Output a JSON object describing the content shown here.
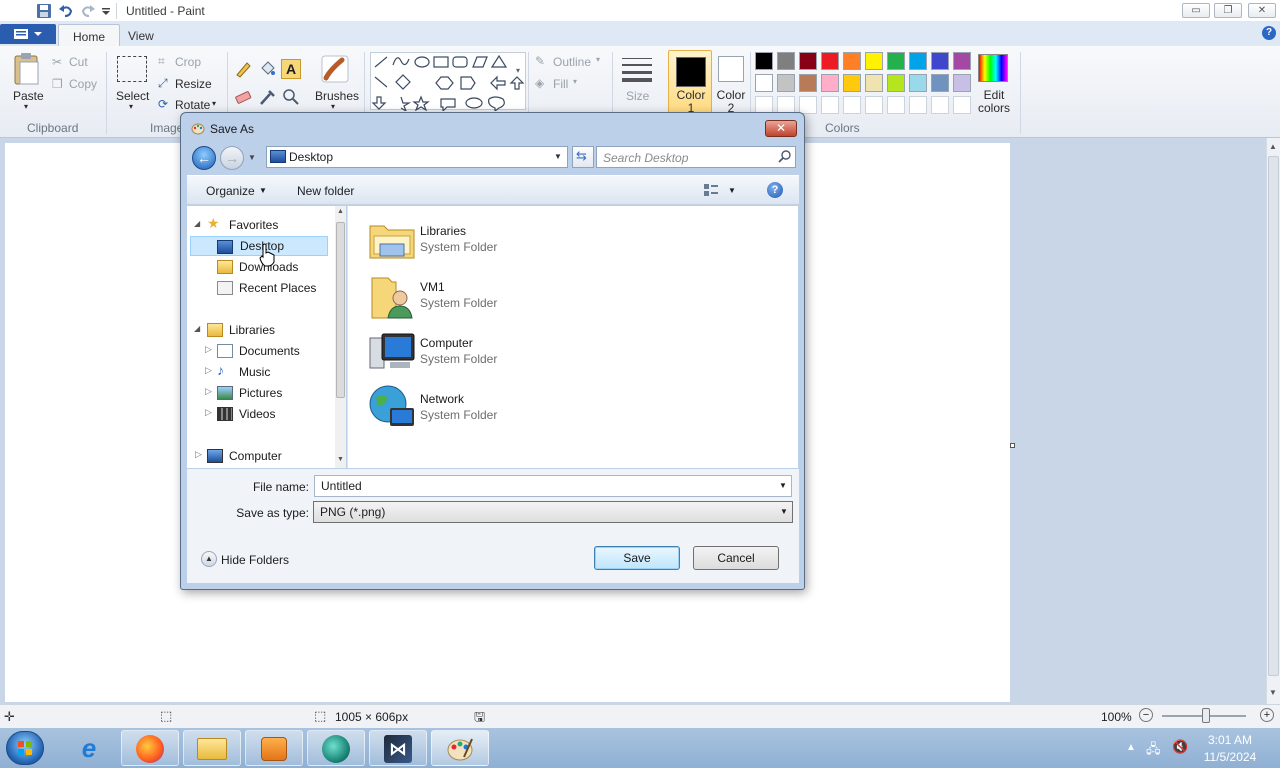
{
  "window": {
    "title": "Untitled - Paint"
  },
  "tabs": [
    {
      "label": "Home"
    },
    {
      "label": "View"
    }
  ],
  "ribbon": {
    "clipboard": {
      "paste": "Paste",
      "cut": "Cut",
      "copy": "Copy",
      "label": "Clipboard"
    },
    "image": {
      "select": "Select",
      "crop": "Crop",
      "resize": "Resize",
      "rotate": "Rotate",
      "label": "Image"
    },
    "tools": {
      "brushes": "Brushes"
    },
    "shapes": {
      "outline": "Outline",
      "fill": "Fill"
    },
    "size": "Size",
    "color1": "Color 1",
    "color2": "Color 2",
    "edit_colors": "Edit colors",
    "colors_label": "Colors",
    "palette_row1": [
      "#000000",
      "#7f7f7f",
      "#880015",
      "#ed1c24",
      "#ff7f27",
      "#fff200",
      "#22b14c",
      "#00a2e8",
      "#3f48cc",
      "#a349a4"
    ],
    "palette_row2": [
      "#ffffff",
      "#c3c3c3",
      "#b97a57",
      "#ffaec9",
      "#ffc90e",
      "#efe4b0",
      "#b5e61d",
      "#99d9ea",
      "#7092be",
      "#c8bfe7"
    ]
  },
  "dialog": {
    "title": "Save As",
    "close": "✕",
    "address": "Desktop",
    "search_placeholder": "Search Desktop",
    "organize": "Organize",
    "new_folder": "New folder",
    "nav": {
      "favorites": "Favorites",
      "desktop": "Desktop",
      "downloads": "Downloads",
      "recent": "Recent Places",
      "libraries": "Libraries",
      "documents": "Documents",
      "music": "Music",
      "pictures": "Pictures",
      "videos": "Videos",
      "computer": "Computer"
    },
    "files": [
      {
        "name": "Libraries",
        "type": "System Folder"
      },
      {
        "name": "VM1",
        "type": "System Folder"
      },
      {
        "name": "Computer",
        "type": "System Folder"
      },
      {
        "name": "Network",
        "type": "System Folder"
      }
    ],
    "file_name_label": "File name:",
    "file_name_value": "Untitled",
    "type_label": "Save as type:",
    "type_value": "PNG (*.png)",
    "hide_folders": "Hide Folders",
    "save": "Save",
    "cancel": "Cancel"
  },
  "status": {
    "dimensions": "1005 × 606px",
    "zoom": "100%"
  },
  "taskbar": {
    "time": "3:01 AM",
    "date": "11/5/2024"
  }
}
